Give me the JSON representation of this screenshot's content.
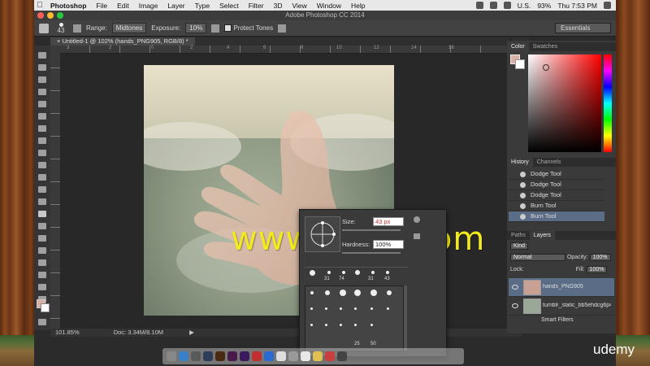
{
  "menubar": {
    "app": "Photoshop",
    "items": [
      "File",
      "Edit",
      "Image",
      "Layer",
      "Type",
      "Select",
      "Filter",
      "3D",
      "View",
      "Window",
      "Help"
    ],
    "locale": "U.S.",
    "battery": "93%",
    "clock": "Thu 7:53 PM"
  },
  "window": {
    "title": "Adobe Photoshop CC 2014"
  },
  "options": {
    "brush_size": "43",
    "range_label": "Range:",
    "range_value": "Midtones",
    "exposure_label": "Exposure:",
    "exposure_value": "10%",
    "protect_tones": "Protect Tones",
    "workspace": "Essentials"
  },
  "document": {
    "tab": "Untitled-1 @ 102% (hands_PNG905, RGB/8) *",
    "ruler_ticks": [
      "3",
      "2",
      "0",
      "2",
      "4",
      "6",
      "8",
      "10",
      "12",
      "14",
      "16"
    ],
    "watermark": "www.cgtsj.com"
  },
  "status": {
    "zoom": "101.85%",
    "doc": "Doc: 3.34M/8.10M"
  },
  "brush_picker": {
    "size_label": "Size:",
    "size_value": "43 px",
    "hardness_label": "Hardness:",
    "hardness_value": "100%",
    "preset_sizes": [
      "31",
      "74",
      "31",
      "43"
    ],
    "grid_numbers": [
      "25",
      "50"
    ]
  },
  "color_panel": {
    "tabs": [
      "Color",
      "Swatches"
    ],
    "foreground": "#d9b0a4",
    "background": "#ffffff"
  },
  "history_panel": {
    "tabs": [
      "History",
      "Channels"
    ],
    "states": [
      "Dodge Tool",
      "Dodge Tool",
      "Dodge Tool",
      "Burn Tool",
      "Burn Tool"
    ]
  },
  "layers_panel": {
    "tabs": [
      "Paths",
      "Layers"
    ],
    "filter": "Kind",
    "blend_mode": "Normal",
    "opacity_label": "Opacity:",
    "opacity": "100%",
    "lock_label": "Lock:",
    "fill_label": "Fill:",
    "fill": "100%",
    "layers": [
      "hands_PNG905",
      "tumblr_static_bb5ehdcg6p4"
    ],
    "smart_filters": "Smart Filters"
  },
  "watermark_brand": "udemy"
}
